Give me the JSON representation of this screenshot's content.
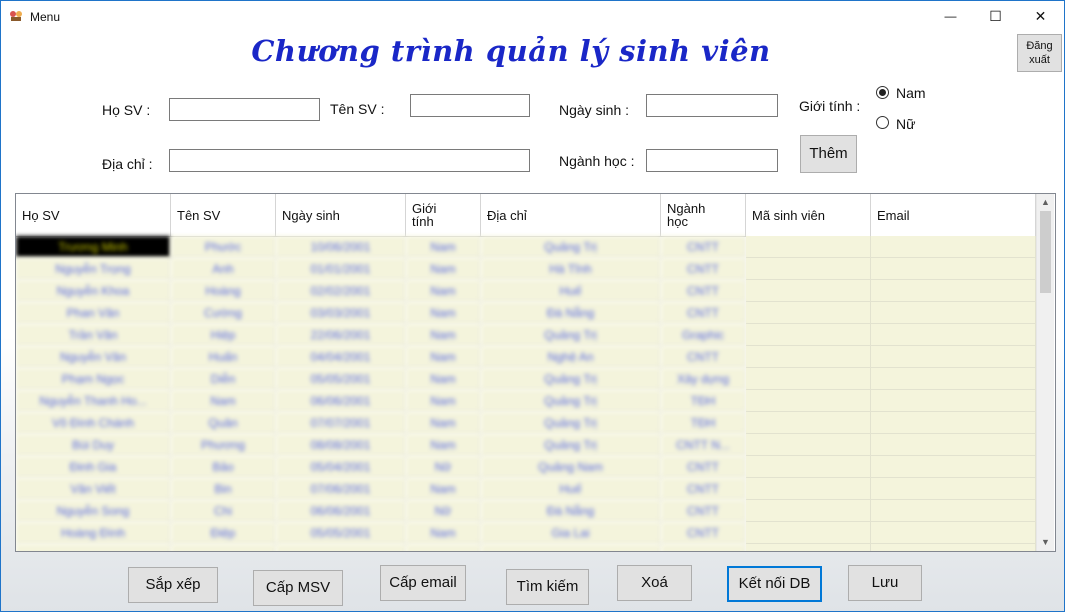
{
  "window": {
    "title": "Menu",
    "controls": {
      "minimize": "—",
      "maximize": "☐",
      "close": "✕"
    }
  },
  "heading": "Chương trình quản lý sinh viên",
  "logout_button": {
    "line1": "Đăng",
    "line2": "xuất"
  },
  "form": {
    "ho_sv_label": "Họ SV :",
    "ten_sv_label": "Tên SV :",
    "ngay_sinh_label": "Ngày sinh :",
    "gioi_tinh_label": "Giới tính :",
    "nam_label": "Nam",
    "nu_label": "Nữ",
    "dia_chi_label": "Địa chỉ :",
    "nganh_hoc_label": "Ngành học :",
    "add_button": "Thêm",
    "gender_selected": "Nam"
  },
  "table": {
    "columns": [
      "Họ SV",
      "Tên SV",
      "Ngày sinh",
      "Giới tính",
      "Địa chỉ",
      "Ngành học",
      "Mã sinh viên",
      "Email"
    ],
    "rows": [
      [
        "Trương Minh",
        "Phước",
        "10/06/2001",
        "Nam",
        "Quảng Trị",
        "CNTT",
        "",
        ""
      ],
      [
        "Nguyễn Trọng",
        "Anh",
        "01/01/2001",
        "Nam",
        "Hà Tĩnh",
        "CNTT",
        "",
        ""
      ],
      [
        "Nguyễn Khoa",
        "Hoàng",
        "02/02/2001",
        "Nam",
        "Huế",
        "CNTT",
        "",
        ""
      ],
      [
        "Phan Văn",
        "Cường",
        "03/03/2001",
        "Nam",
        "Đà Nẵng",
        "CNTT",
        "",
        ""
      ],
      [
        "Trần Văn",
        "Hiệp",
        "22/06/2001",
        "Nam",
        "Quảng Trị",
        "Graphic",
        "",
        ""
      ],
      [
        "Nguyễn Văn",
        "Huấn",
        "04/04/2001",
        "Nam",
        "Nghệ An",
        "CNTT",
        "",
        ""
      ],
      [
        "Phạm Ngọc",
        "Diễn",
        "05/05/2001",
        "Nam",
        "Quảng Trị",
        "Xây dựng",
        "",
        ""
      ],
      [
        "Nguyễn Thanh Ho...",
        "Nam",
        "06/06/2001",
        "Nam",
        "Quảng Trị",
        "TĐH",
        "",
        ""
      ],
      [
        "Võ Đình Chánh",
        "Quân",
        "07/07/2001",
        "Nam",
        "Quảng Trị",
        "TĐH",
        "",
        ""
      ],
      [
        "Bùi Duy",
        "Phương",
        "08/08/2001",
        "Nam",
        "Quảng Trị",
        "CNTT N...",
        "",
        ""
      ],
      [
        "Đinh Gia",
        "Bảo",
        "05/04/2001",
        "Nữ",
        "Quảng Nam",
        "CNTT",
        "",
        ""
      ],
      [
        "Văn Viết",
        "Bin",
        "07/06/2001",
        "Nam",
        "Huế",
        "CNTT",
        "",
        ""
      ],
      [
        "Nguyễn Song",
        "Chi",
        "06/06/2001",
        "Nữ",
        "Đà Nẵng",
        "CNTT",
        "",
        ""
      ],
      [
        "Hoàng Đình",
        "Điệp",
        "05/05/2001",
        "Nam",
        "Gia Lai",
        "CNTT",
        "",
        ""
      ],
      [
        "",
        "",
        "",
        "",
        "",
        "",
        "",
        ""
      ]
    ]
  },
  "buttons": [
    "Sắp xếp",
    "Cấp MSV",
    "Cấp email",
    "Tìm kiếm",
    "Xoá",
    "Kết nối DB",
    "Lưu"
  ],
  "scroll": {
    "up": "▲",
    "down": "▼"
  }
}
